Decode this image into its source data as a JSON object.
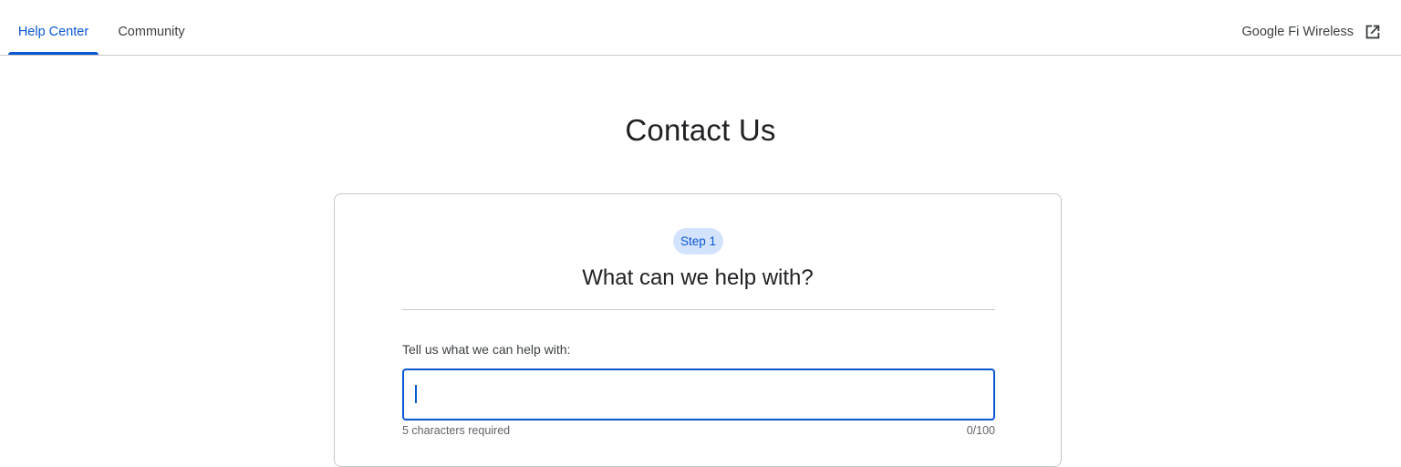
{
  "nav": {
    "tabs": [
      {
        "label": "Help Center",
        "active": true
      },
      {
        "label": "Community",
        "active": false
      }
    ],
    "product_link": {
      "label": "Google Fi Wireless",
      "icon": "open-in-new-icon"
    }
  },
  "page": {
    "title": "Contact Us"
  },
  "form": {
    "step_chip": "Step 1",
    "heading": "What can we help with?",
    "field_label": "Tell us what we can help with:",
    "input_value": "",
    "helper_text": "5 characters required",
    "counter": "0/100"
  },
  "colors": {
    "accent": "#0b57d0",
    "chip_bg": "#d3e3fd",
    "border": "#c4c7c5",
    "text": "#202124"
  }
}
